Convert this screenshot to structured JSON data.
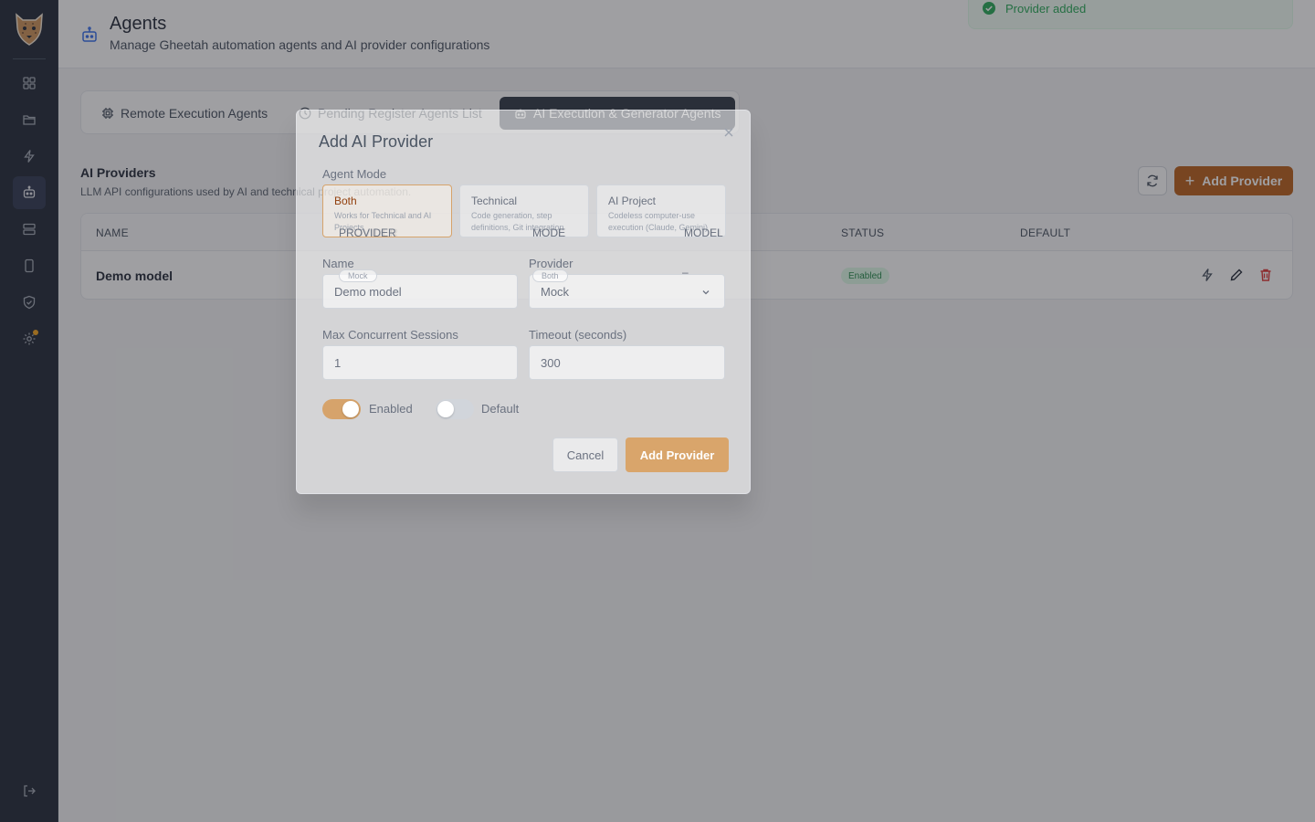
{
  "sidebar": {
    "items": [
      {
        "icon": "dashboard-icon"
      },
      {
        "icon": "folder-icon"
      },
      {
        "icon": "lightning-icon"
      },
      {
        "icon": "bot-icon",
        "active": true
      },
      {
        "icon": "server-icon"
      },
      {
        "icon": "mobile-icon"
      },
      {
        "icon": "shield-icon"
      },
      {
        "icon": "gear-icon",
        "notification": true
      }
    ],
    "logout_icon": "logout-icon"
  },
  "header": {
    "title": "Agents",
    "subtitle": "Manage Gheetah automation agents and AI provider configurations"
  },
  "toast": {
    "text": "Provider added",
    "color": "#16a34a"
  },
  "tabs": [
    {
      "label": "Remote Execution Agents",
      "icon": "cpu-icon"
    },
    {
      "label": "Pending Register Agents List",
      "icon": "clock-icon"
    },
    {
      "label": "AI Execution & Generator Agents",
      "icon": "bot-icon",
      "active": true
    }
  ],
  "section": {
    "title": "AI Providers",
    "description": "LLM API configurations used by AI and technical project automation.",
    "add_button_label": "Add Provider"
  },
  "table": {
    "columns": [
      "NAME",
      "PROVIDER",
      "MODE",
      "MODEL",
      "STATUS",
      "DEFAULT"
    ],
    "rows": [
      {
        "name": "Demo model",
        "provider": "Mock",
        "mode": "Both",
        "model": "–",
        "status": "Enabled",
        "default": ""
      }
    ]
  },
  "modal": {
    "title": "Add AI Provider",
    "agent_mode_label": "Agent Mode",
    "modes": [
      {
        "title": "Both",
        "description": "Works for Technical and AI Projects",
        "selected": true
      },
      {
        "title": "Technical",
        "description": "Code generation, step definitions, Git integration"
      },
      {
        "title": "AI Project",
        "description": "Codeless computer-use execution (Claude, Gemini)"
      }
    ],
    "name_label": "Name",
    "name_value": "Demo model",
    "provider_label": "Provider",
    "provider_value": "Mock",
    "max_sessions_label": "Max Concurrent Sessions",
    "max_sessions_value": "1",
    "timeout_label": "Timeout (seconds)",
    "timeout_value": "300",
    "enabled_label": "Enabled",
    "enabled": true,
    "default_label": "Default",
    "default": false,
    "cancel_label": "Cancel",
    "submit_label": "Add Provider"
  },
  "colors": {
    "sidebar_bg": "#111827",
    "accent": "#b45309",
    "success": "#16a34a",
    "danger": "#dc2626"
  }
}
